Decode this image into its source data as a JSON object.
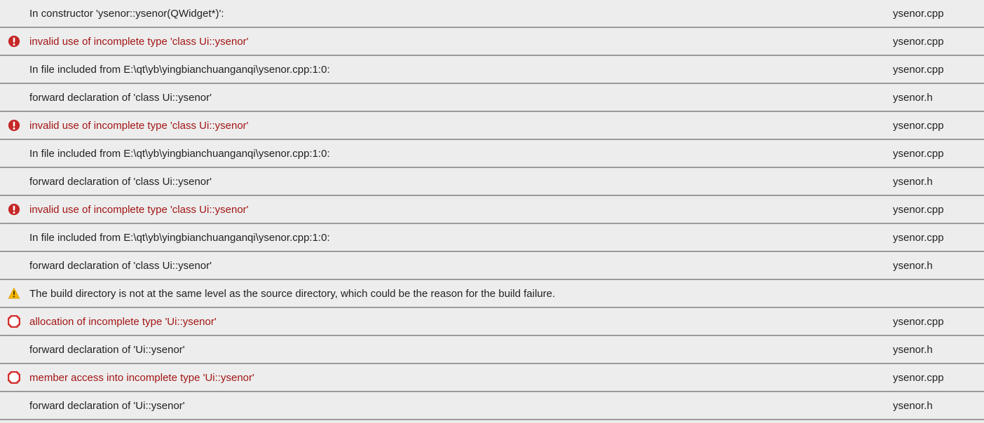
{
  "issues": [
    {
      "icon": "none",
      "error": false,
      "msg": "In constructor 'ysenor::ysenor(QWidget*)':",
      "file": "ysenor.cpp"
    },
    {
      "icon": "error-circle",
      "error": true,
      "msg": "invalid use of incomplete type 'class Ui::ysenor'",
      "file": "ysenor.cpp"
    },
    {
      "icon": "none",
      "error": false,
      "msg": "In file included from E:\\qt\\yb\\yingbianchuanganqi\\ysenor.cpp:1:0:",
      "file": "ysenor.cpp"
    },
    {
      "icon": "none",
      "error": false,
      "msg": "forward declaration of 'class Ui::ysenor'",
      "file": "ysenor.h"
    },
    {
      "icon": "error-circle",
      "error": true,
      "msg": "invalid use of incomplete type 'class Ui::ysenor'",
      "file": "ysenor.cpp"
    },
    {
      "icon": "none",
      "error": false,
      "msg": "In file included from E:\\qt\\yb\\yingbianchuanganqi\\ysenor.cpp:1:0:",
      "file": "ysenor.cpp"
    },
    {
      "icon": "none",
      "error": false,
      "msg": "forward declaration of 'class Ui::ysenor'",
      "file": "ysenor.h"
    },
    {
      "icon": "error-circle",
      "error": true,
      "msg": "invalid use of incomplete type 'class Ui::ysenor'",
      "file": "ysenor.cpp"
    },
    {
      "icon": "none",
      "error": false,
      "msg": "In file included from E:\\qt\\yb\\yingbianchuanganqi\\ysenor.cpp:1:0:",
      "file": "ysenor.cpp"
    },
    {
      "icon": "none",
      "error": false,
      "msg": "forward declaration of 'class Ui::ysenor'",
      "file": "ysenor.h"
    },
    {
      "icon": "warning",
      "error": false,
      "msg": "The build directory is not at the same level as the source directory, which could be the reason for the build failure.",
      "file": ""
    },
    {
      "icon": "error-octagon",
      "error": true,
      "msg": "allocation of incomplete type 'Ui::ysenor'",
      "file": "ysenor.cpp"
    },
    {
      "icon": "none",
      "error": false,
      "msg": "forward declaration of 'Ui::ysenor'",
      "file": "ysenor.h"
    },
    {
      "icon": "error-octagon",
      "error": true,
      "msg": "member access into incomplete type 'Ui::ysenor'",
      "file": "ysenor.cpp"
    },
    {
      "icon": "none",
      "error": false,
      "msg": "forward declaration of 'Ui::ysenor'",
      "file": "ysenor.h"
    }
  ],
  "icon_svgs": {
    "error-circle": "<svg class='icon' viewBox='0 0 20 20'><circle cx='10' cy='10' r='9' fill='#c62828'/><rect x='8.6' y='4' width='2.8' height='8' rx='1.2' fill='white'/><circle cx='10' cy='15' r='1.6' fill='white'/></svg>",
    "warning": "<svg class='icon' viewBox='0 0 20 20'><polygon points='10,1 19,18 1,18' fill='#f4b400' stroke='#c68e00' stroke-width='0.5'/><rect x='9' y='6' width='2' height='6' fill='#5c4b00'/><rect x='9' y='6' width='2' height='6' fill='#5c4a00'/><rect x='9' y='6' width='2' height='6' fill='#4d3b00'/><circle cx='10' cy='15' r='1.3' fill='#4d3b00'/></svg>",
    "error-octagon": "<svg class='icon' viewBox='0 0 20 20'><polygon points='6,1 14,1 19,6 19,14 14,19 6,19 1,14 1,6' fill='white' stroke='#d32f2f' stroke-width='3'/></svg>",
    "none": ""
  }
}
